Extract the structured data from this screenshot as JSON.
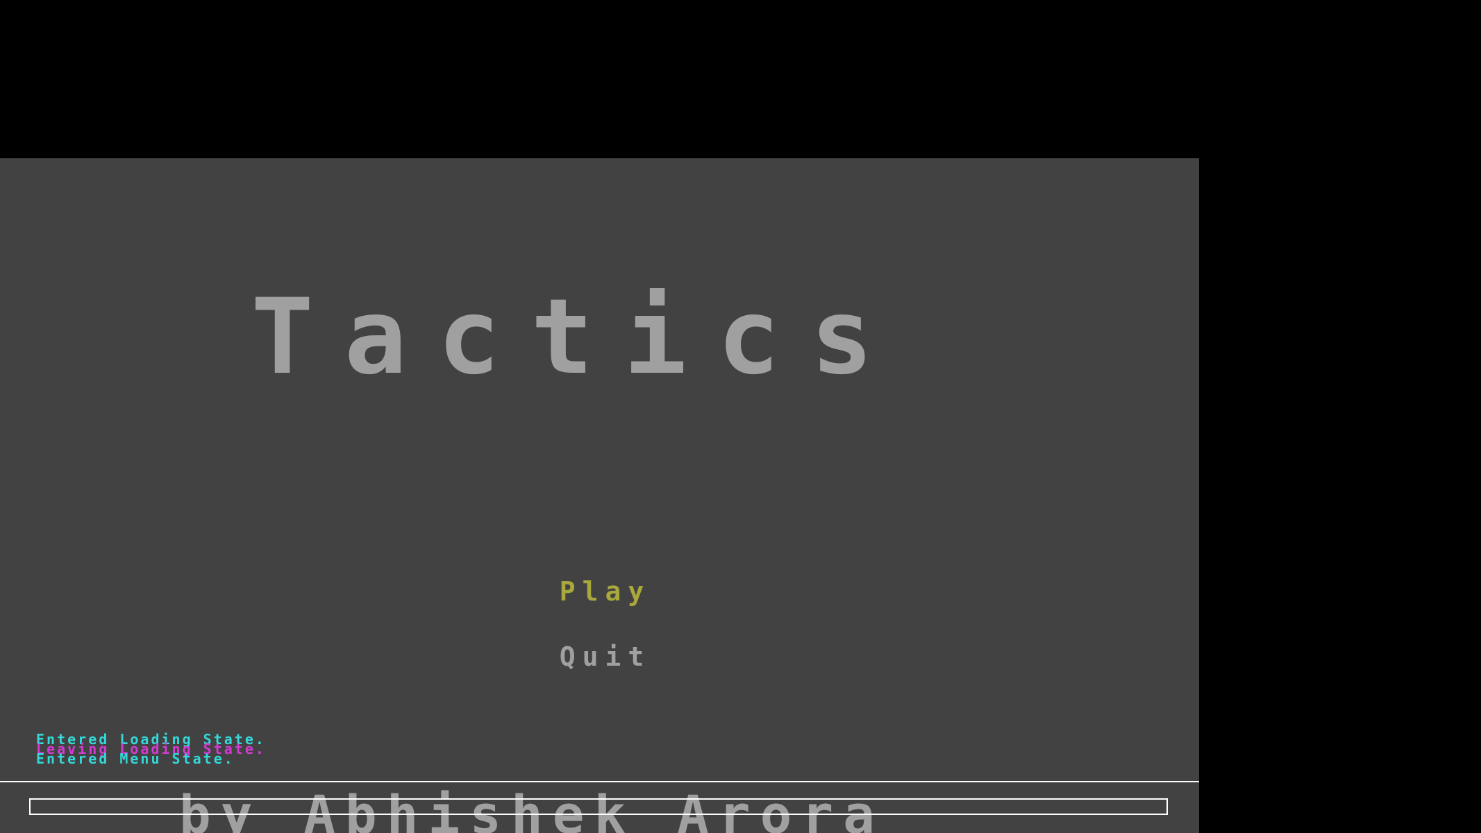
{
  "game": {
    "title": "Tactics",
    "credit": "by Abhishek Arora"
  },
  "menu": {
    "items": [
      {
        "label": "Play",
        "selected": true,
        "color": "#a8a83c"
      },
      {
        "label": "Quit",
        "selected": false,
        "color": "#a0a0a0"
      }
    ]
  },
  "console": {
    "lines": [
      {
        "text": "Entered Loading State.",
        "color": "#34d8d8"
      },
      {
        "text": "Leaving Loading State.",
        "color": "#d43ad4"
      },
      {
        "text": "Entered Menu State.",
        "color": "#34d8d8"
      }
    ],
    "input_value": ""
  },
  "colors": {
    "background": "#424242",
    "letterbox": "#000000",
    "title_gray": "#a0a0a0",
    "selected_yellow": "#a8a83c"
  }
}
